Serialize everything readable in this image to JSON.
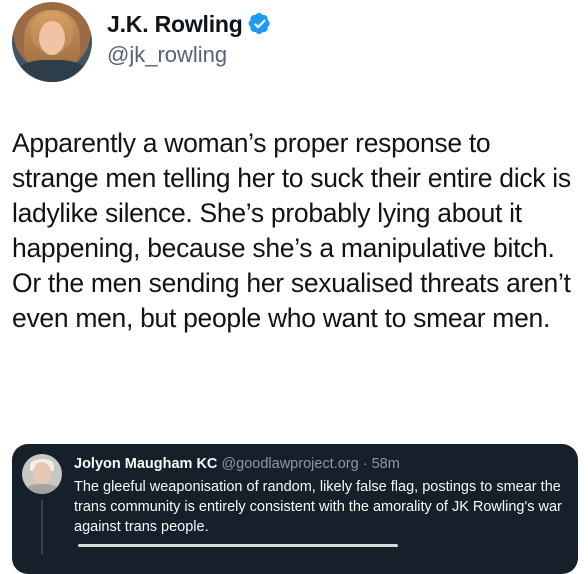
{
  "author": {
    "name": "J.K. Rowling",
    "handle": "@jk_rowling",
    "verified": true,
    "verified_color": "#1d9bf0"
  },
  "tweet": {
    "text": "Apparently a woman’s proper response to strange men telling her to suck their entire dick is ladylike silence. She’s probably lying about it happening, because she’s a manipulative bitch. Or the men sending her sexualised threats aren’t even men, but people who want to smear men."
  },
  "quoted_tweet": {
    "name": "Jolyon Maugham KC",
    "handle": "@goodlawproject.org",
    "separator": "·",
    "time": "58m",
    "text": "The gleeful weaponisation of random, likely false flag, postings to smear the trans community is entirely consistent with the amorality of JK Rowling's war against trans people.",
    "background": "#15202b"
  }
}
